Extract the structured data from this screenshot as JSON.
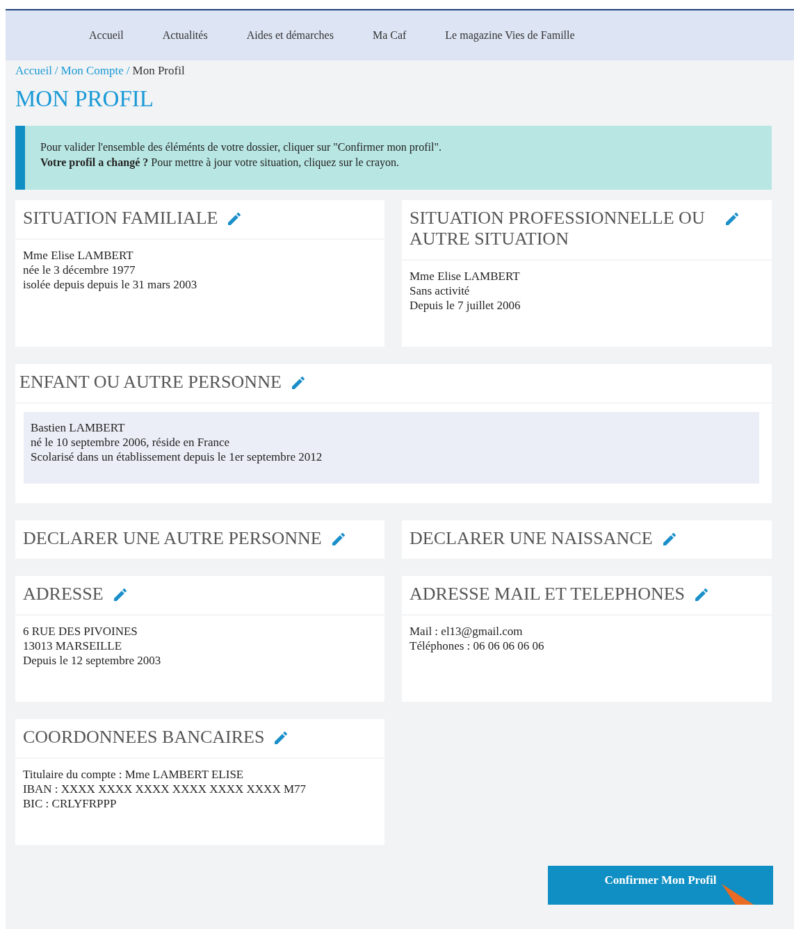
{
  "nav": [
    {
      "label": "Accueil"
    },
    {
      "label": "Actualités"
    },
    {
      "label": "Aides et démarches"
    },
    {
      "label": "Ma Caf"
    },
    {
      "label": "Le magazine Vies de Famille"
    }
  ],
  "breadcrumb": [
    {
      "label": "Accueil",
      "kind": "link"
    },
    {
      "label": "/",
      "kind": "separator"
    },
    {
      "label": "Mon Compte",
      "kind": "link"
    },
    {
      "label": "/",
      "kind": "separator"
    },
    {
      "label": "Mon Profil",
      "kind": "current"
    }
  ],
  "title": "MON PROFIL",
  "notice": [
    "Pour valider l'ensemble des éléménts de votre dossier, cliquer sur \"Confirmer mon profil\".",
    "**Votre profil a changé ?** Pour mettre à jour votre situation, cliquez sur le crayon."
  ],
  "sections": [
    {
      "title": "SITUATION FAMILIALE",
      "kind": "plain",
      "lines": [
        "Mme Elise LAMBERT",
        "née le 3 décembre 1977",
        "isolée depuis depuis le 31 mars 2003"
      ]
    },
    {
      "title": "SITUATION PROFESSIONNELLE OU AUTRE SITUATION",
      "kind": "plain",
      "lines": [
        "Mme Elise LAMBERT",
        "Sans activité",
        "Depuis le 7 juillet 2006"
      ]
    },
    {
      "title": "ENFANT OU AUTRE PERSONNE",
      "kind": "boxed",
      "lines": [
        "Bastien LAMBERT",
        "né le 10 septembre 2006, réside en France",
        "Scolarisé dans un établissement depuis le 1er septembre 2012"
      ]
    },
    {
      "title": "DECLARER UNE AUTRE PERSONNE",
      "kind": "header"
    },
    {
      "title": "DECLARER UNE NAISSANCE",
      "kind": "header"
    },
    {
      "title": "ADRESSE",
      "kind": "plain",
      "lines": [
        "6 RUE DES PIVOINES",
        "13013 MARSEILLE",
        "Depuis le 12 septembre 2003"
      ]
    },
    {
      "title": "ADRESSE MAIL ET TELEPHONES",
      "kind": "plain",
      "lines": [
        "Mail : el13@gmail.com",
        "Téléphones : 06 06 06 06 06"
      ]
    },
    {
      "title": "COORDONNEES BANCAIRES",
      "kind": "plain",
      "lines": [
        "Titulaire du compte : Mme LAMBERT ELISE",
        "IBAN : XXXX XXXX XXXX XXXX XXXX XXXX M77",
        "BIC : CRLYFRPPP"
      ]
    }
  ],
  "confirm_button": "Confirmer Mon Profil"
}
